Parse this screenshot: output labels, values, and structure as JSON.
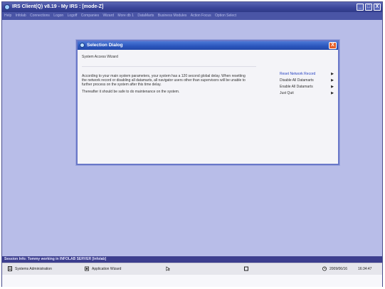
{
  "window": {
    "title": "IRS Client(Q) v8.19 - My IRS :       [mode-Z]",
    "controls": {
      "minimize": "_",
      "maximize": "□",
      "close": "X"
    }
  },
  "menu": {
    "items": [
      "Help",
      "Infolab",
      "Connections",
      "Logon",
      "Logoff",
      "Companies",
      "Wizard",
      "More db 1",
      "DataMarts",
      "Business Modules",
      "Action Focus",
      "Option Select"
    ]
  },
  "dialog": {
    "title": "Selection Dialog",
    "close": "X",
    "subtitle": "System Access Wizard",
    "body": [
      "According to your main system parameters, your system has a 120 second global delay. When resetting the network record or disabling all datamarts, all navigator users other than supervisors will be unable to further process on the system after this time delay.",
      "Thereafter it should be safe to do maintenance on the system."
    ],
    "actions": [
      {
        "label": "Reset Network Record",
        "arrow": "▶"
      },
      {
        "label": "Disable All Datamarts",
        "arrow": "▶"
      },
      {
        "label": "Enable All Datamarts",
        "arrow": "▶"
      },
      {
        "label": "Just Quit",
        "arrow": "▶"
      }
    ]
  },
  "session": {
    "info": "Session Info: Tommy working in INFOLAB SERVER [Infolab]"
  },
  "taskbar": {
    "systems_admin": "Systems Administration",
    "app_wizard": "Application Wizard",
    "date": "2009/06/16",
    "time": "16:34:47"
  },
  "icons": [
    "app-logo-icon",
    "systems-admin-icon",
    "app-wizard-icon",
    "pointer-icon",
    "square-icon",
    "clock-icon",
    "dialog-logo-icon"
  ],
  "colors": {
    "accent": "#3b469a",
    "dialog_title": "#2a55bc",
    "close": "#e6602a",
    "link": "#2a45c2"
  }
}
